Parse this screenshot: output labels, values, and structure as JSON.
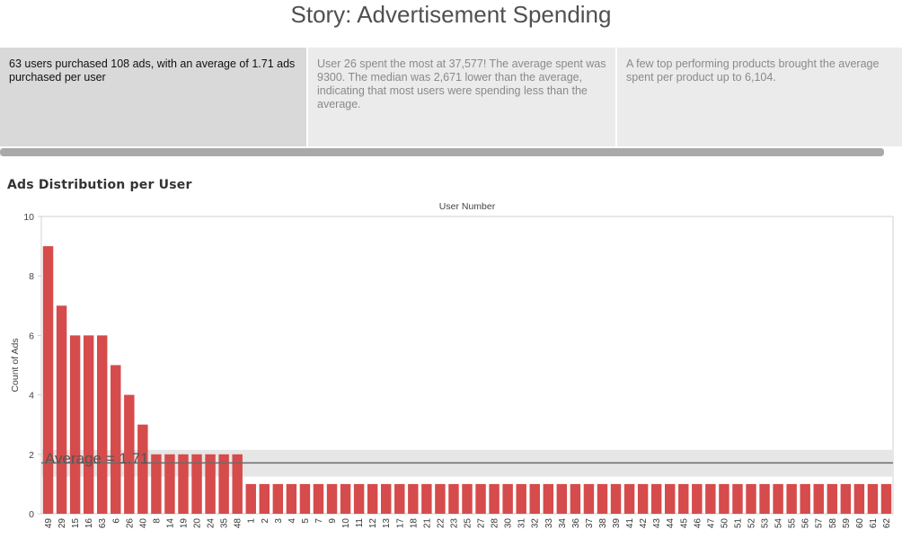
{
  "story": {
    "title": "Story: Advertisement Spending",
    "points": [
      "63 users purchased 108 ads, with an average of 1.71 ads purchased per user",
      "User 26 spent the most at 37,577!  The average spent was 9300.  The median was 2,671 lower than the average, indicating that most users were spending less than the average.",
      "A few top performing products brought the average spent per product up to 6,104."
    ],
    "active_point": 0
  },
  "sheet": {
    "title": "Ads Distribution per User"
  },
  "colors": {
    "bar": "#d64b4b",
    "average_band": "#e6e6e6",
    "average_line": "#6b6b6b",
    "axis": "#d0d0d0"
  },
  "chart_data": {
    "type": "bar",
    "title": "Ads Distribution per User",
    "xlabel": "User Number",
    "ylabel": "Count of Ads",
    "ylim": [
      0,
      10
    ],
    "yticks": [
      0,
      2,
      4,
      6,
      8,
      10
    ],
    "x_axis_position": "top",
    "grid": false,
    "categories": [
      "49",
      "29",
      "15",
      "16",
      "63",
      "6",
      "26",
      "40",
      "8",
      "14",
      "19",
      "20",
      "24",
      "35",
      "48",
      "1",
      "2",
      "3",
      "4",
      "5",
      "7",
      "9",
      "10",
      "11",
      "12",
      "13",
      "17",
      "18",
      "21",
      "22",
      "23",
      "25",
      "27",
      "28",
      "30",
      "31",
      "32",
      "33",
      "34",
      "36",
      "37",
      "38",
      "39",
      "41",
      "42",
      "43",
      "44",
      "45",
      "46",
      "47",
      "50",
      "51",
      "52",
      "53",
      "54",
      "55",
      "56",
      "57",
      "58",
      "59",
      "60",
      "61",
      "62"
    ],
    "values": [
      9,
      7,
      6,
      6,
      6,
      5,
      4,
      3,
      2,
      2,
      2,
      2,
      2,
      2,
      2,
      1,
      1,
      1,
      1,
      1,
      1,
      1,
      1,
      1,
      1,
      1,
      1,
      1,
      1,
      1,
      1,
      1,
      1,
      1,
      1,
      1,
      1,
      1,
      1,
      1,
      1,
      1,
      1,
      1,
      1,
      1,
      1,
      1,
      1,
      1,
      1,
      1,
      1,
      1,
      1,
      1,
      1,
      1,
      1,
      1,
      1,
      1,
      1
    ],
    "reference_line": {
      "label": "Average = 1.71",
      "value": 1.71,
      "band": [
        1.25,
        2.15
      ]
    }
  }
}
